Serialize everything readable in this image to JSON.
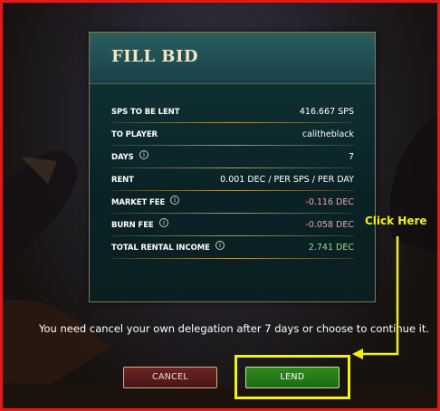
{
  "modal": {
    "title": "FILL BID",
    "rows": [
      {
        "label": "SPS TO BE LENT",
        "value": "416.667 SPS",
        "info": false,
        "value_color": "#ffffff"
      },
      {
        "label": "TO PLAYER",
        "value": "calitheblack",
        "info": false,
        "value_color": "#ffffff"
      },
      {
        "label": "DAYS",
        "value": "7",
        "info": true,
        "value_color": "#ffffff"
      },
      {
        "label": "RENT",
        "value": "0.001 DEC / PER SPS / PER DAY",
        "info": false,
        "value_color": "#ffffff"
      },
      {
        "label": "MARKET FEE",
        "value": "-0.116 DEC",
        "info": true,
        "value_color": "#f2a6a6"
      },
      {
        "label": "BURN FEE",
        "value": "-0.058 DEC",
        "info": true,
        "value_color": "#f2a6a6"
      },
      {
        "label": "TOTAL RENTAL INCOME",
        "value": "2.741 DEC",
        "info": true,
        "value_color": "#9ee07a"
      }
    ]
  },
  "notice": "You need cancel your own delegation after 7 days or choose to continue it.",
  "buttons": {
    "cancel": "CANCEL",
    "lend": "LEND"
  },
  "annotation": {
    "text": "Click Here",
    "color": "#f2f20a"
  },
  "colors": {
    "frame_border": "#e11919",
    "lend_green": "#2e8a1e",
    "cancel_red": "#6a2424"
  }
}
